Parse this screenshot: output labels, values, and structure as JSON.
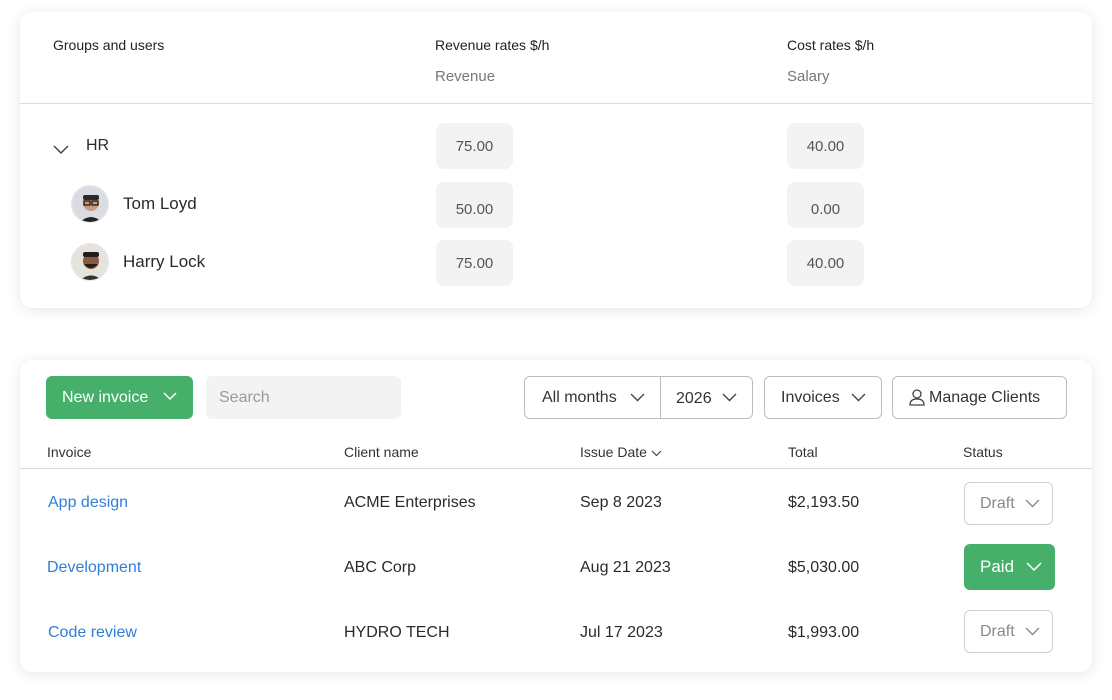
{
  "rates": {
    "col_groups": "Groups and users",
    "col_revenue": "Revenue rates  $/h",
    "col_revenue_sub": "Revenue",
    "col_cost": "Cost rates  $/h",
    "col_cost_sub": "Salary",
    "group": {
      "name": "HR",
      "revenue": "75.00",
      "cost": "40.00"
    },
    "users": [
      {
        "name": "Tom Loyd",
        "revenue": "50.00",
        "cost": "0.00"
      },
      {
        "name": "Harry Lock",
        "revenue": "75.00",
        "cost": "40.00"
      }
    ]
  },
  "invoices": {
    "new_button": "New invoice",
    "search_placeholder": "Search",
    "filter_month": "All months",
    "filter_year": "2026",
    "filter_type": "Invoices",
    "manage_clients": "Manage Clients",
    "columns": {
      "invoice": "Invoice",
      "client": "Client name",
      "issue_date": "Issue Date",
      "total": "Total",
      "status": "Status"
    },
    "rows": [
      {
        "invoice": "App design",
        "client": "ACME Enterprises",
        "date": "Sep 8 2023",
        "total": "$2,193.50",
        "status": "Draft"
      },
      {
        "invoice": "Development",
        "client": "ABC Corp",
        "date": "Aug 21 2023",
        "total": "$5,030.00",
        "status": "Paid"
      },
      {
        "invoice": "Code review",
        "client": "HYDRO TECH",
        "date": "Jul 17 2023",
        "total": "$1,993.00",
        "status": "Draft"
      }
    ]
  },
  "colors": {
    "accent_green": "#46b06a",
    "link_blue": "#2f7fd6"
  }
}
